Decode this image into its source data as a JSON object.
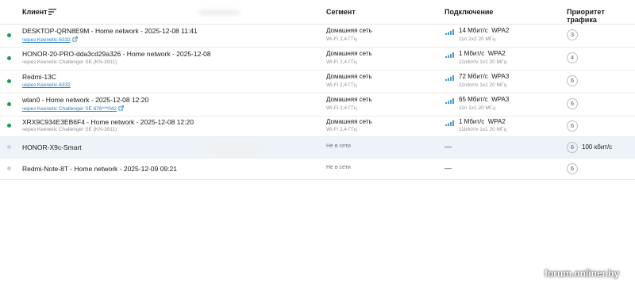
{
  "header": {
    "client": "Клиент",
    "segment": "Сегмент",
    "connection": "Подключение",
    "priority": "Приоритет трафика"
  },
  "icons": {
    "sort": "sort-lines-icon",
    "external": "external-link-icon",
    "signal": "wifi-signal-bars-icon"
  },
  "colors": {
    "online": "#1d9d4d",
    "offline": "#cdd2d6",
    "link": "#2a82c8",
    "highlight": "#edf3f9",
    "signal": "#4a9ad4"
  },
  "rows": [
    {
      "name": "DESKTOP-QRN8E9M - Home network - 2025-12-08 11:41",
      "sub": "через Keenetic-6332",
      "segment": "Домашняя сеть",
      "segment_sub": "Wi-Fi 2,4 ГГц",
      "speed": "14 Мбит/с",
      "security": "WPA2",
      "conn_sub": "11n 2x2 20 МГц",
      "priority": "3"
    },
    {
      "name": "HONOR-20-PRO-dda3cd29a326 - Home network - 2025-12-08",
      "sub": "через Keenetic Challenger SE (KN-3911)",
      "segment": "Домашняя сеть",
      "segment_sub": "Wi-Fi 2,4 ГГц",
      "speed": "1 Мбит/с",
      "security": "WPA2",
      "conn_sub": "11n/k/r/v 1x1 20 МГц",
      "priority": "4"
    },
    {
      "name": "Redmi-13C",
      "sub": "через Keenetic-6332",
      "segment": "Домашняя сеть",
      "segment_sub": "Wi-Fi 2,4 ГГц",
      "speed": "72 Мбит/с",
      "security": "WPA3",
      "conn_sub": "11n/k/r/v 1x1 20 МГц",
      "priority": "6"
    },
    {
      "name": "wlan0 - Home network - 2025-12-08 12:20",
      "sub": "через Keenetic Challenger SE 676***042",
      "segment": "Домашняя сеть",
      "segment_sub": "Wi-Fi 2,4 ГГц",
      "speed": "65 Мбит/с",
      "security": "WPA3",
      "conn_sub": "11n 1x1 20 МГц",
      "priority": "6"
    },
    {
      "name": "XRX9C934E3EB6F4 - Home network - 2025-12-08 12:20",
      "sub": "через Keenetic Challenger SE (KN-3911)",
      "segment": "Домашняя сеть",
      "segment_sub": "Wi-Fi 2,4 ГГц",
      "speed": "1 Мбит/с",
      "security": "WPA2",
      "conn_sub": "11b/k/r/v 1x1 20 МГц",
      "priority": "6"
    },
    {
      "name": "HONOR-X9c-Smart",
      "segment": "Не в сети",
      "connection": "—",
      "priority": "6",
      "rate_limit": "100 кбит/с"
    },
    {
      "name": "Redmi-Note-8T - Home network - 2025-12-09 09:21",
      "segment": "Не в сети",
      "connection": "—",
      "priority": "6"
    }
  ],
  "watermark": "forum.onliner.by"
}
